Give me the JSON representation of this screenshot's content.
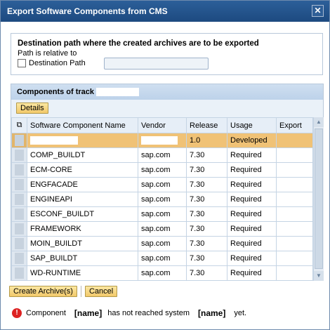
{
  "dialog": {
    "title": "Export Software Components from CMS",
    "close_glyph": "✕"
  },
  "destination": {
    "heading": "Destination path where the created archives are to be exported",
    "sub": "Path is relative to",
    "checkbox_label": "Destination Path"
  },
  "track": {
    "header": "Components of track",
    "details_button": "Details",
    "columns": [
      "Software Component Name",
      "Vendor",
      "Release",
      "Usage",
      "Export"
    ],
    "rows": [
      {
        "name": "",
        "vendor": "",
        "release": "1.0",
        "usage": "Developed",
        "export": ""
      },
      {
        "name": "COMP_BUILDT",
        "vendor": "sap.com",
        "release": "7.30",
        "usage": "Required",
        "export": ""
      },
      {
        "name": "ECM-CORE",
        "vendor": "sap.com",
        "release": "7.30",
        "usage": "Required",
        "export": ""
      },
      {
        "name": "ENGFACADE",
        "vendor": "sap.com",
        "release": "7.30",
        "usage": "Required",
        "export": ""
      },
      {
        "name": "ENGINEAPI",
        "vendor": "sap.com",
        "release": "7.30",
        "usage": "Required",
        "export": ""
      },
      {
        "name": "ESCONF_BUILDT",
        "vendor": "sap.com",
        "release": "7.30",
        "usage": "Required",
        "export": ""
      },
      {
        "name": "FRAMEWORK",
        "vendor": "sap.com",
        "release": "7.30",
        "usage": "Required",
        "export": ""
      },
      {
        "name": "MOIN_BUILDT",
        "vendor": "sap.com",
        "release": "7.30",
        "usage": "Required",
        "export": ""
      },
      {
        "name": "SAP_BUILDT",
        "vendor": "sap.com",
        "release": "7.30",
        "usage": "Required",
        "export": ""
      },
      {
        "name": "WD-RUNTIME",
        "vendor": "sap.com",
        "release": "7.30",
        "usage": "Required",
        "export": ""
      }
    ]
  },
  "actions": {
    "create_archives": "Create Archive(s)",
    "cancel": "Cancel"
  },
  "message": {
    "icon": "error-icon",
    "part1": "Component",
    "name1": "[name]",
    "part2": "has not reached system",
    "name2": "[name]",
    "part3": "yet."
  }
}
